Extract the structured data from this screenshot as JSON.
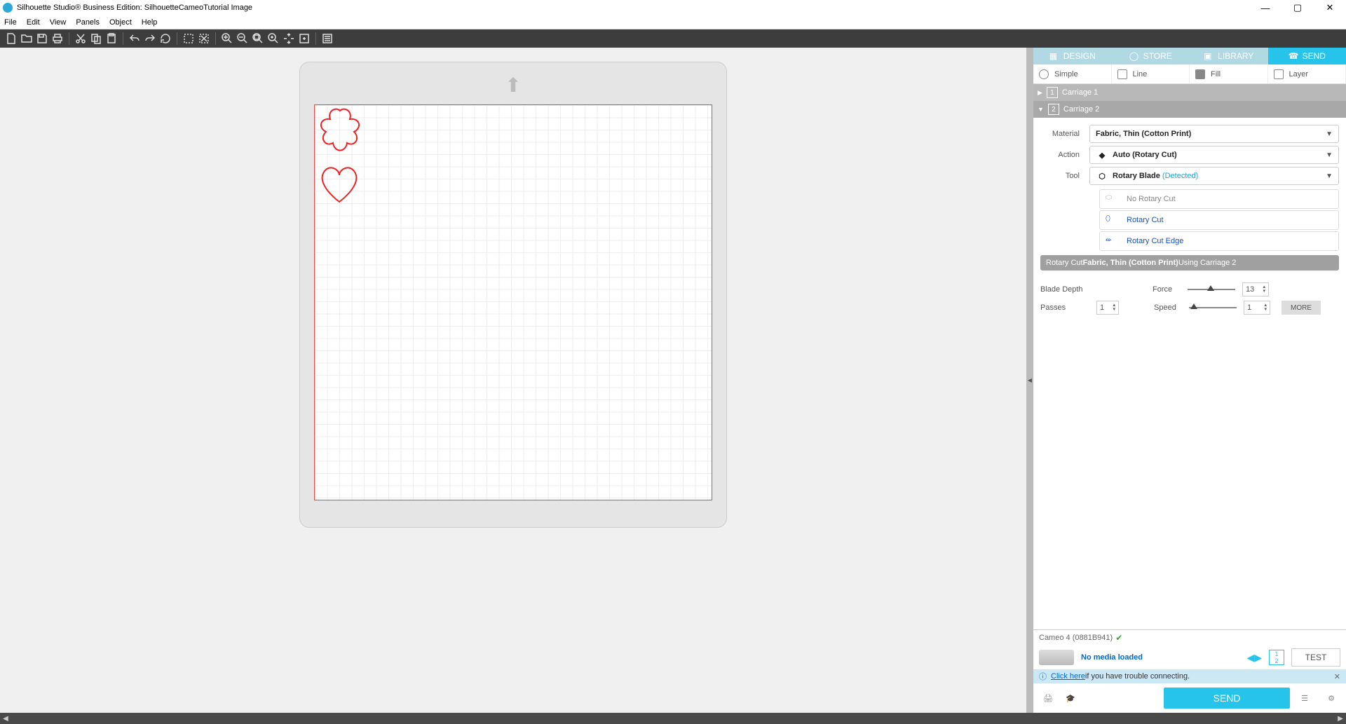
{
  "title": "Silhouette Studio® Business Edition: SilhouetteCameoTutorial Image",
  "menu": {
    "file": "File",
    "edit": "Edit",
    "view": "View",
    "panels": "Panels",
    "object": "Object",
    "help": "Help"
  },
  "topTabs": {
    "design": "DESIGN",
    "store": "STORE",
    "library": "LIBRARY",
    "send": "SEND"
  },
  "modeTabs": {
    "simple": "Simple",
    "line": "Line",
    "fill": "Fill",
    "layer": "Layer"
  },
  "carriages": {
    "c1": "Carriage 1",
    "c2": "Carriage 2"
  },
  "settings": {
    "materialLabel": "Material",
    "materialValue": "Fabric, Thin (Cotton Print)",
    "actionLabel": "Action",
    "actionValue": "Auto (Rotary Cut)",
    "toolLabel": "Tool",
    "toolValue": "Rotary Blade ",
    "toolDetected": "(Detected)"
  },
  "options": {
    "noRotary": "No Rotary Cut",
    "rotary": "Rotary Cut",
    "rotaryEdge": "Rotary Cut Edge"
  },
  "cutInfo": {
    "pre": "Rotary Cut ",
    "mat": "Fabric, Thin (Cotton Print) ",
    "post": "Using Carriage 2"
  },
  "params": {
    "bladeLabel": "Blade Depth",
    "forceLabel": "Force",
    "forceValue": "13",
    "passesLabel": "Passes",
    "passesValue": "1",
    "speedLabel": "Speed",
    "speedValue": "1",
    "more": "MORE"
  },
  "device": {
    "name": "Cameo 4 (0881B941)"
  },
  "media": {
    "text": "No media loaded",
    "test": "TEST"
  },
  "trouble": {
    "link": "Click here",
    "text": " if you have trouble connecting."
  },
  "send": "SEND"
}
